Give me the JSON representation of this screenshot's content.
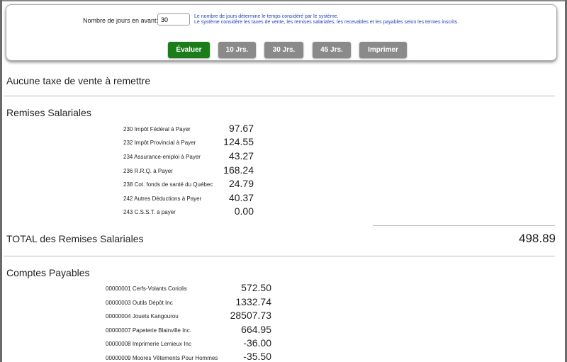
{
  "controls": {
    "days_label": "Nombre de jours en avant:",
    "days_value": "30",
    "hint_line1": "Le nombre de jours détermine le temps considéré par le système.",
    "hint_line2": "Le système considère les taxes de vente, les remises salariales, les recevables et les payables selon les termes inscrits.",
    "buttons": {
      "evaluate": "Évaluer",
      "days10": "10 Jrs.",
      "days30": "30 Jrs.",
      "days45": "45 Jrs.",
      "print": "Imprimer"
    }
  },
  "sales_tax": {
    "message": "Aucune taxe de vente à remettre"
  },
  "payroll": {
    "title": "Remises Salariales",
    "items": [
      {
        "label": "230 Impôt Fédéral à Payer",
        "value": "97.67"
      },
      {
        "label": "232 Impôt Provincial à Payer",
        "value": "124.55"
      },
      {
        "label": "234 Assurance-emploi à Payer",
        "value": "43.27"
      },
      {
        "label": "236 R.R.Q. à Payer",
        "value": "168.24"
      },
      {
        "label": "238 Cot. fonds de santé du Québec",
        "value": "24.79"
      },
      {
        "label": "242 Autres Déductions à Payer",
        "value": "40.37"
      },
      {
        "label": "243 C.S.S.T. à payer",
        "value": "0.00"
      }
    ],
    "total_label": "TOTAL des Remises Salariales",
    "total_value": "498.89"
  },
  "payables": {
    "title": "Comptes Payables",
    "items": [
      {
        "label": "00000001 Cerfs-Volants Coriolis",
        "value": "572.50"
      },
      {
        "label": "00000003 Outils Dépôt Inc",
        "value": "1332.74"
      },
      {
        "label": "00000004 Jouets Kangourou",
        "value": "28507.73"
      },
      {
        "label": "00000007 Papeterie Blainville Inc.",
        "value": "664.95"
      },
      {
        "label": "00000008 Imprimerie Lemieux Inc",
        "value": "-36.00"
      },
      {
        "label": "00000009 Moores Vêtements Pour Hommes",
        "value": "-35.50"
      }
    ]
  }
}
